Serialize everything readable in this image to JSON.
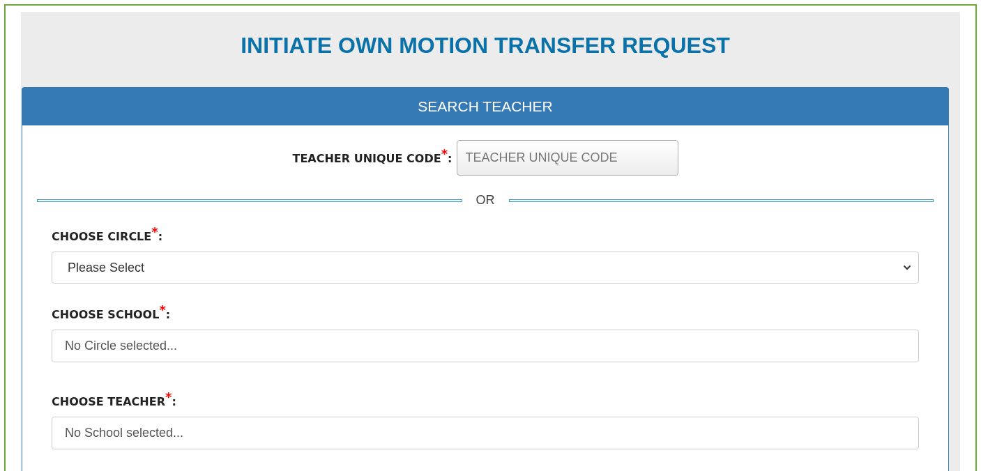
{
  "title": "INITIATE OWN MOTION TRANSFER REQUEST",
  "panel": {
    "heading": "SEARCH TEACHER",
    "code_field": {
      "label": "TEACHER UNIQUE CODE",
      "required_mark": "*",
      "suffix": ":",
      "placeholder": "TEACHER UNIQUE CODE"
    },
    "divider_text": "OR",
    "fields": [
      {
        "kind": "select",
        "label": "CHOOSE CIRCLE",
        "required_mark": "*",
        "suffix": ":",
        "value": "Please Select"
      },
      {
        "kind": "text",
        "label": "CHOOSE SCHOOL",
        "required_mark": "*",
        "suffix": ":",
        "value": "No Circle selected..."
      },
      {
        "kind": "text",
        "label": "CHOOSE TEACHER",
        "required_mark": "*",
        "suffix": ":",
        "value": "No School selected..."
      }
    ]
  }
}
